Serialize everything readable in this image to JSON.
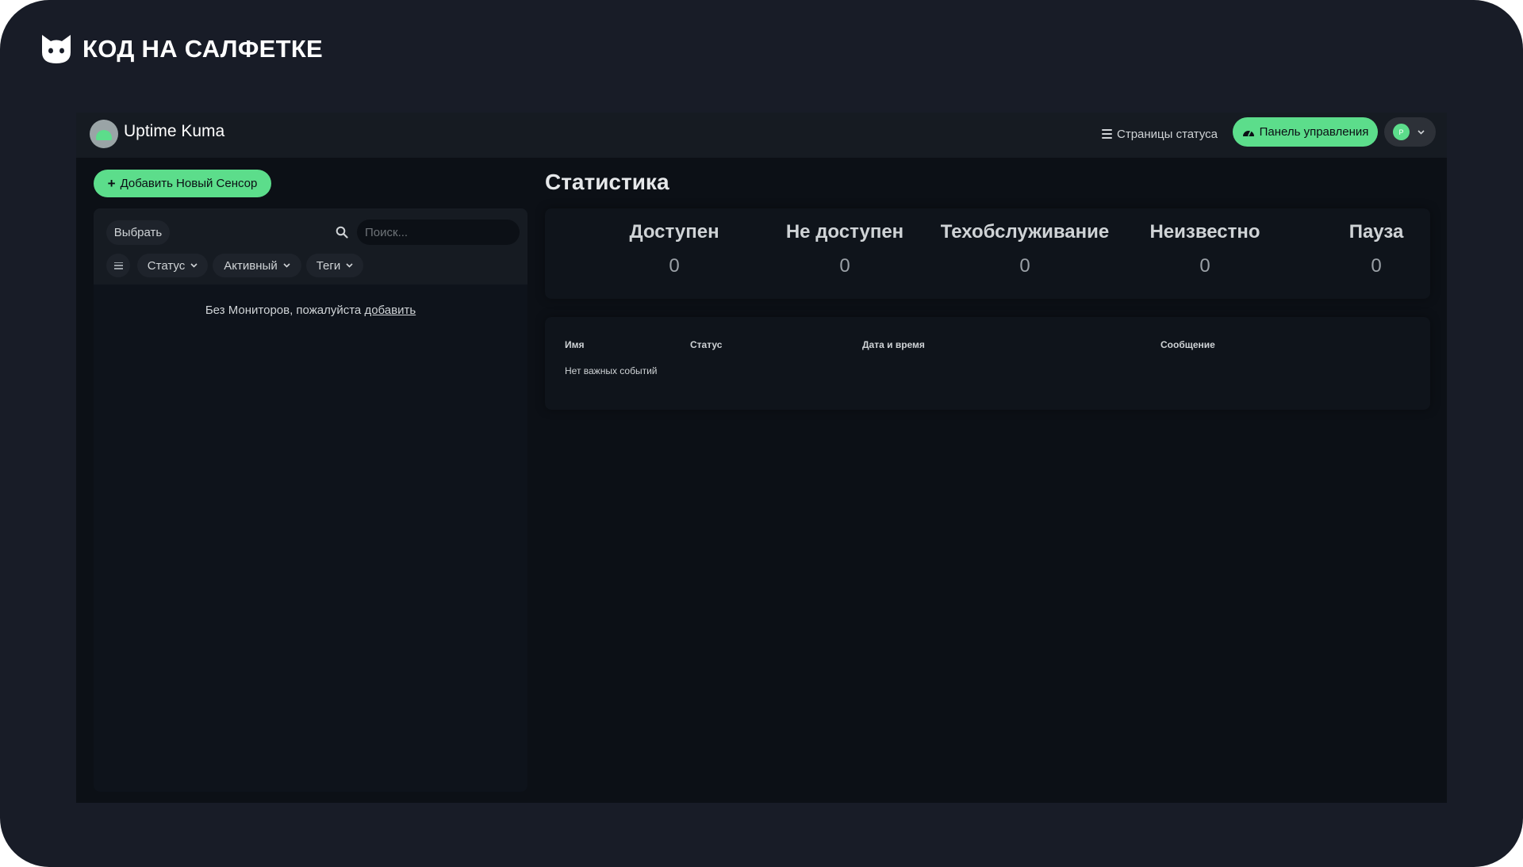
{
  "brand": {
    "text": "КОД НА САЛФЕТКЕ",
    "logo_icon": "cat-head-icon"
  },
  "header": {
    "app_title": "Uptime Kuma",
    "status_pages_label": "Страницы статуса",
    "dashboard_label": "Панель управления",
    "avatar_initial": "P",
    "accent_color": "#5cdd8b"
  },
  "sidebar": {
    "add_monitor_label": "Добавить Новый Сенсор",
    "select_label": "Выбрать",
    "search_placeholder": "Поиск...",
    "filters": {
      "status": "Статус",
      "active": "Активный",
      "tags": "Теги"
    },
    "empty_text": "Без Мониторов, пожалуйста",
    "empty_link": "добавить"
  },
  "stats": {
    "heading": "Статистика",
    "items": [
      {
        "label": "Доступен",
        "value": "0"
      },
      {
        "label": "Не доступен",
        "value": "0"
      },
      {
        "label": "Техобслуживание",
        "value": "0"
      },
      {
        "label": "Неизвестно",
        "value": "0"
      },
      {
        "label": "Пауза",
        "value": "0"
      }
    ]
  },
  "events": {
    "columns": [
      "Имя",
      "Статус",
      "Дата и время",
      "Сообщение"
    ],
    "empty_text": "Нет важных событий"
  }
}
